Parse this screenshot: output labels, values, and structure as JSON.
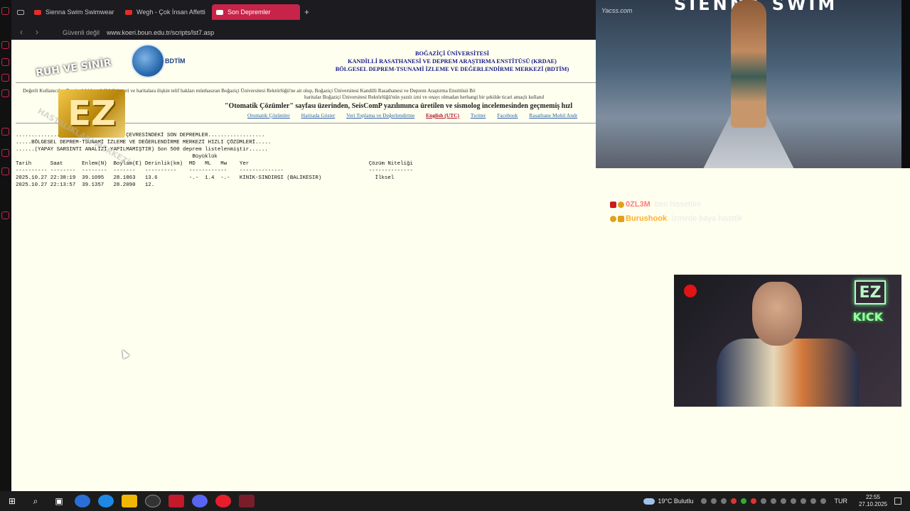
{
  "browser": {
    "tabs": [
      {
        "label": "Sienna Swim Swimwear F"
      },
      {
        "label": "Wegh - Çok İnsan Affetti"
      },
      {
        "label": "Son Depremler"
      }
    ],
    "new_tab": "+",
    "address": {
      "insecure_label": "Güvenli değil",
      "url": "www.koeri.boun.edu.tr/scripts/lst7.asp"
    }
  },
  "page": {
    "bdtim_label": "BDTİM",
    "institution_lines": [
      "BOĞAZİÇİ ÜNİVERSİTESİ",
      "KANDİLLİ RASATHANESİ VE DEPREM ARAŞTIRMA ENSTİTÜSÜ (KRDAE)",
      "BÖLGESEL DEPREM-TSUNAMİ İZLEME VE DEĞERLENDİRME MERKEZİ (BDTİM)"
    ],
    "notice_line1": "Değerli Kullanıcılar, Bu sitedeki her türlü bilgi, veri ve haritalara ilişkin telif hakları münhasıran Boğaziçi Üniversitesi Rektörlüğü'ne ait olup, Boğaziçi Üniversitesi Kandilli Rasathanesi ve Deprem Araştırma Enstitüsü Bö",
    "notice_line2": "haritalar Boğaziçi Üniversitesi Rektörlüğü'nün yazılı izni ve onayı olmadan herhangi bir şekilde ticari amaçlı kullanıl",
    "subtitle": "\"Otomatik Çözümler\" sayfası üzerinden, SeisComP yazılımınca üretilen ve sismolog incelemesinden geçmemiş hızl",
    "links": [
      "Otomatik Çözümler",
      "Haritada Göster",
      "Veri Toplama ve Değerlendirme",
      "English (UTC)",
      "Twitter",
      "Facebook",
      "Rasathane Mobil Andr"
    ],
    "list_header_lines": [
      "..................TÜRKİYE VE YAKIN ÇEVRESİNDEKİ SON DEPREMLER..................",
      ".....BÖLGESEL DEPREM-TSUNAMİ İZLEME VE DEĞERLENDİRME MERKEZİ HIZLI ÇÖZÜMLERİ.....",
      "......(YAPAY SARSINTI ANALİZİ YAPILMAMIŞTIR) Son 500 deprem listelenmiştir......"
    ],
    "columns_line1": "                                                        Büyüklük",
    "columns_line2": "Tarih      Saat      Enlem(N)  Boylam(E) Derinlik(km)  MD   ML   Mw    Yer                                      Çözüm Niteliği",
    "separator_line": "---------- --------  --------  -------   ----------    ------------    --------------                           --------------",
    "rows": [
      {
        "date": "2025.10.27",
        "time": "22:38:19",
        "lat": "39.1095",
        "lon": "28.1863",
        "depth": "13.6",
        "md": "-.-",
        "ml": "1.4",
        "mw": "-.-",
        "place": "KINIK-SINDIRGI (BALIKESIR)",
        "quality": "İlksel"
      },
      {
        "date": "2025.10.27",
        "time": "22:13:57",
        "lat": "39.1357",
        "lon": "28.2090",
        "depth": "12.",
        "md": "",
        "ml": "",
        "mw": "",
        "place": "",
        "quality": ""
      }
    ]
  },
  "overlay": {
    "watermark_top": "RUH VE SİNİR",
    "watermark_logo": "EZ",
    "watermark_bottom": "HASTALIKLARI MERKEZİ",
    "video_site": "Yacss.com",
    "video_title": "SIENNA SWIM",
    "chat": [
      {
        "user": "0ZL3M",
        "message": ": ben hissettim"
      },
      {
        "user": "Burushook",
        "message": ": İzmirde baya hissttik"
      }
    ],
    "cam_ez": "EZ",
    "cam_kick": "KICK"
  },
  "taskbar": {
    "weather": "19°C  Bulutlu",
    "lang": "TUR",
    "time": "22:55",
    "date": "27.10.2025"
  }
}
